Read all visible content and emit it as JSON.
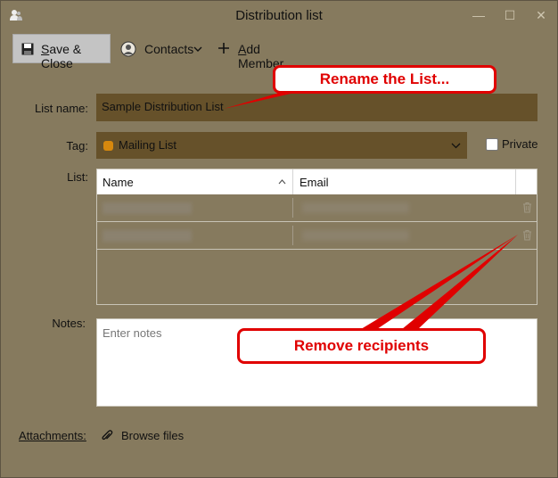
{
  "window": {
    "title": "Distribution list",
    "controls": {
      "minimize": "—",
      "maximize": "☐",
      "close": "✕"
    }
  },
  "toolbar": {
    "save_close_label": "Save & Close",
    "contacts_label": "Contacts",
    "add_member_label": "Add Member"
  },
  "form": {
    "list_name_label": "List name:",
    "list_name_value": "Sample Distribution List",
    "tag_label": "Tag:",
    "tag_value": "Mailing List",
    "tag_color": "#d7880d",
    "private_label": "Private",
    "private_checked": false,
    "list_label": "List:",
    "notes_label": "Notes:",
    "notes_placeholder": "Enter notes",
    "attachments_label": "Attachments:",
    "browse_label": "Browse files"
  },
  "members_table": {
    "columns": [
      "Name",
      "Email"
    ],
    "rows": [
      {},
      {}
    ]
  },
  "annotations": {
    "rename": "Rename the List...",
    "remove": "Remove recipients"
  },
  "colors": {
    "background": "#867a5e",
    "field": "#66512a",
    "annotation": "#e00000"
  }
}
